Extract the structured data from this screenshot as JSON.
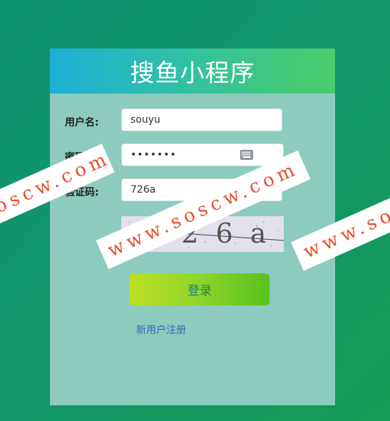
{
  "header": {
    "title": "搜鱼小程序"
  },
  "form": {
    "username_label": "用户名:",
    "username_value": "souyu",
    "password_label": "密码:",
    "password_value": "•••••••",
    "captcha_label": "验证码:",
    "captcha_value": "726a",
    "captcha_image_text": "7 2 6 a"
  },
  "actions": {
    "login_label": "登录",
    "register_label": "新用户注册"
  },
  "watermark": {
    "text_left": "soscw.com",
    "text_center": "www.soscw.com",
    "text_right": "www.so"
  },
  "colors": {
    "page_bg": "#119469",
    "card_bg": "#8ccbbd",
    "header_gradient_start": "#1bb0d8",
    "header_gradient_end": "#4bcb68",
    "button_gradient_start": "#bcdf22",
    "button_gradient_end": "#57c31f",
    "watermark_text": "#e5502f"
  },
  "icons": {
    "password_toggle": "keyboard-icon"
  }
}
